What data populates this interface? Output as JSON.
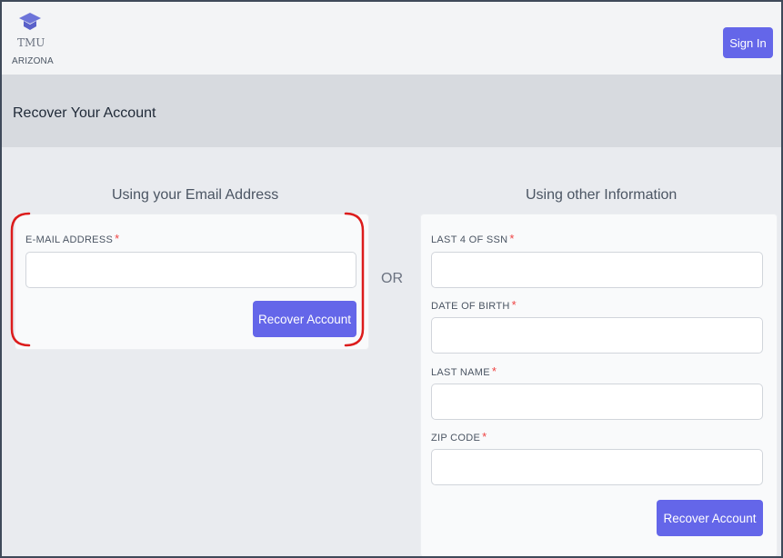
{
  "header": {
    "logo_text": "TMU",
    "logo_sub": "ARIZONA",
    "signin_label": "Sign In"
  },
  "page_title": "Recover Your Account",
  "email_section": {
    "heading": "Using your Email Address",
    "fields": [
      {
        "label": "E-MAIL ADDRESS",
        "required_mark": "*",
        "value": "",
        "placeholder": ""
      }
    ],
    "button_label": "Recover Account"
  },
  "or_label": "OR",
  "info_section": {
    "heading": "Using other Information",
    "fields": [
      {
        "label": "LAST 4 OF SSN",
        "required_mark": "*",
        "value": "",
        "placeholder": ""
      },
      {
        "label": "DATE OF BIRTH",
        "required_mark": "*",
        "value": "",
        "placeholder": ""
      },
      {
        "label": "LAST NAME",
        "required_mark": "*",
        "value": "",
        "placeholder": ""
      },
      {
        "label": "ZIP CODE",
        "required_mark": "*",
        "value": "",
        "placeholder": ""
      }
    ],
    "button_label": "Recover Account"
  },
  "colors": {
    "accent": "#6466e9",
    "required": "#ef4444",
    "highlight": "#dc1c1c"
  }
}
